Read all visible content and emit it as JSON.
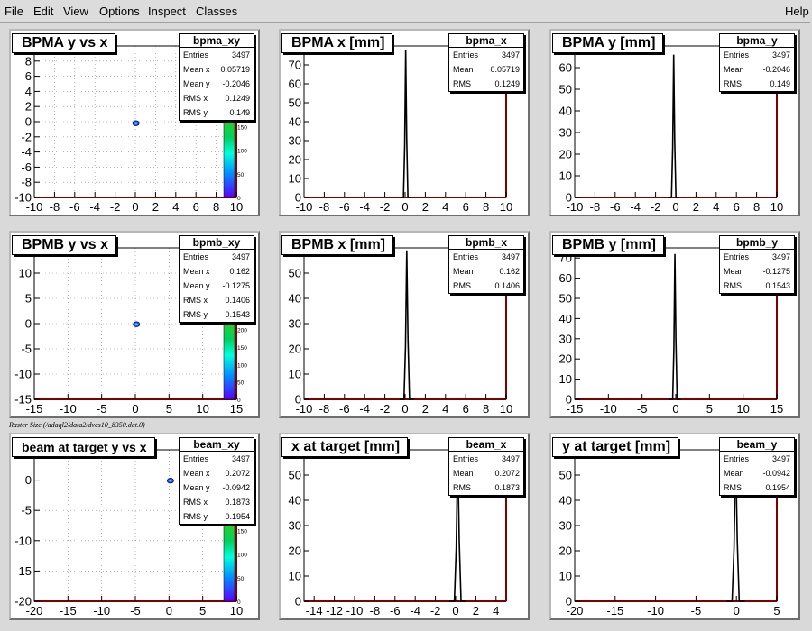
{
  "menu": {
    "file": "File",
    "edit": "Edit",
    "view": "View",
    "options": "Options",
    "inspect": "Inspect",
    "classes": "Classes",
    "help": "Help"
  },
  "caption": "Raster Size (/adaql2/data2/dvcs10_8350.dat.0)",
  "colors": {
    "hist_line": "#000000",
    "frame": "#800000",
    "grid": "#888888"
  },
  "pads": [
    {
      "id": "bpma-xy",
      "title": "BPMA y vs x",
      "type": "scatter2d",
      "stats": {
        "name": "bpma_xy",
        "rows": [
          [
            "Entries",
            "3497"
          ],
          [
            "Mean x",
            "0.05719"
          ],
          [
            "Mean y",
            "-0.2046"
          ],
          [
            "RMS x",
            "0.1249"
          ],
          [
            "RMS y",
            "0.149"
          ]
        ]
      },
      "xaxis": {
        "min": -10,
        "max": 10,
        "ticks": [
          "-10",
          "-8",
          "-6",
          "-4",
          "-2",
          "0",
          "2",
          "4",
          "6",
          "8",
          "10"
        ]
      },
      "yaxis": {
        "min": -10,
        "max": 10,
        "ticks": [
          "-10",
          "-8",
          "-6",
          "-4",
          "-2",
          "0",
          "2",
          "4",
          "6",
          "8"
        ]
      },
      "spot": {
        "x": 0.05719,
        "y": -0.2046
      },
      "palette_ticks": [
        "150",
        "100",
        "50",
        "0"
      ],
      "palette_max": 170
    },
    {
      "id": "bpma-x",
      "title": "BPMA x [mm]",
      "type": "hist1d",
      "stats": {
        "name": "bpma_x",
        "rows": [
          [
            "Entries",
            "3497"
          ],
          [
            "Mean",
            "0.05719"
          ],
          [
            "RMS",
            "0.1249"
          ]
        ]
      },
      "xaxis": {
        "min": -10,
        "max": 10,
        "ticks": [
          "-10",
          "-8",
          "-6",
          "-4",
          "-2",
          "0",
          "2",
          "4",
          "6",
          "8",
          "10"
        ]
      },
      "yaxis": {
        "min": 0,
        "max": 80,
        "ticks": [
          "0",
          "10",
          "20",
          "30",
          "40",
          "50",
          "60",
          "70",
          "80"
        ]
      },
      "peak": {
        "mean": 0.05719,
        "height": 78,
        "width": 0.4
      }
    },
    {
      "id": "bpma-y",
      "title": "BPMA y [mm]",
      "type": "hist1d",
      "stats": {
        "name": "bpma_y",
        "rows": [
          [
            "Entries",
            "3497"
          ],
          [
            "Mean",
            "-0.2046"
          ],
          [
            "RMS",
            "0.149"
          ]
        ]
      },
      "xaxis": {
        "min": -10,
        "max": 10,
        "ticks": [
          "-10",
          "-8",
          "-6",
          "-4",
          "-2",
          "0",
          "2",
          "4",
          "6",
          "8",
          "10"
        ]
      },
      "yaxis": {
        "min": 0,
        "max": 70,
        "ticks": [
          "0",
          "10",
          "20",
          "30",
          "40",
          "50",
          "60"
        ]
      },
      "peak": {
        "mean": -0.2046,
        "height": 66,
        "width": 0.4
      }
    },
    {
      "id": "bpmb-xy",
      "title": "BPMB y vs x",
      "type": "scatter2d",
      "stats": {
        "name": "bpmb_xy",
        "rows": [
          [
            "Entries",
            "3497"
          ],
          [
            "Mean x",
            "0.162"
          ],
          [
            "Mean y",
            "-0.1275"
          ],
          [
            "RMS x",
            "0.1406"
          ],
          [
            "RMS y",
            "0.1543"
          ]
        ]
      },
      "xaxis": {
        "min": -15,
        "max": 15,
        "ticks": [
          "-15",
          "-10",
          "-5",
          "0",
          "5",
          "10",
          "15"
        ]
      },
      "yaxis": {
        "min": -15,
        "max": 15,
        "ticks": [
          "-15",
          "-10",
          "-5",
          "0",
          "5",
          "10"
        ]
      },
      "spot": {
        "x": 0.162,
        "y": -0.1275
      },
      "palette_ticks": [
        "200",
        "150",
        "100",
        "50",
        "0"
      ],
      "palette_max": 230
    },
    {
      "id": "bpmb-x",
      "title": "BPMB x [mm]",
      "type": "hist1d",
      "stats": {
        "name": "bpmb_x",
        "rows": [
          [
            "Entries",
            "3497"
          ],
          [
            "Mean",
            "0.162"
          ],
          [
            "RMS",
            "0.1406"
          ]
        ]
      },
      "xaxis": {
        "min": -10,
        "max": 10,
        "ticks": [
          "-10",
          "-8",
          "-6",
          "-4",
          "-2",
          "0",
          "2",
          "4",
          "6",
          "8",
          "10"
        ]
      },
      "yaxis": {
        "min": 0,
        "max": 60,
        "ticks": [
          "0",
          "10",
          "20",
          "30",
          "40",
          "50",
          "60"
        ]
      },
      "peak": {
        "mean": 0.162,
        "height": 59,
        "width": 0.5
      }
    },
    {
      "id": "bpmb-y",
      "title": "BPMB y [mm]",
      "type": "hist1d",
      "stats": {
        "name": "bpmb_y",
        "rows": [
          [
            "Entries",
            "3497"
          ],
          [
            "Mean",
            "-0.1275"
          ],
          [
            "RMS",
            "0.1543"
          ]
        ]
      },
      "xaxis": {
        "min": -15,
        "max": 15,
        "ticks": [
          "-15",
          "-10",
          "-5",
          "0",
          "5",
          "10",
          "15"
        ]
      },
      "yaxis": {
        "min": 0,
        "max": 75,
        "ticks": [
          "0",
          "10",
          "20",
          "30",
          "40",
          "50",
          "60",
          "70"
        ]
      },
      "peak": {
        "mean": -0.1275,
        "height": 72,
        "width": 0.6
      }
    },
    {
      "id": "beam-xy",
      "title": "beam at target y vs x",
      "type": "scatter2d",
      "small_title": true,
      "stats": {
        "name": "beam_xy",
        "rows": [
          [
            "Entries",
            "3497"
          ],
          [
            "Mean x",
            "0.2072"
          ],
          [
            "Mean y",
            "-0.0942"
          ],
          [
            "RMS x",
            "0.1873"
          ],
          [
            "RMS y",
            "0.1954"
          ]
        ]
      },
      "xaxis": {
        "min": -20,
        "max": 10,
        "ticks": [
          "-20",
          "-15",
          "-10",
          "-5",
          "0",
          "5",
          "10"
        ]
      },
      "yaxis": {
        "min": -20,
        "max": 5,
        "ticks": [
          "-20",
          "-15",
          "-10",
          "-5",
          "0",
          "5"
        ]
      },
      "spot": {
        "x": 0.2072,
        "y": -0.0942
      },
      "palette_ticks": [
        "150",
        "100",
        "50",
        "0"
      ],
      "palette_max": 170
    },
    {
      "id": "beam-x",
      "title": "x at target [mm]",
      "type": "hist1d",
      "stats": {
        "name": "beam_x",
        "rows": [
          [
            "Entries",
            "3497"
          ],
          [
            "Mean",
            "0.2072"
          ],
          [
            "RMS",
            "0.1873"
          ]
        ]
      },
      "xaxis": {
        "min": -15,
        "max": 5,
        "ticks": [
          "-14",
          "-12",
          "-10",
          "-8",
          "-6",
          "-4",
          "-2",
          "0",
          "2",
          "4"
        ]
      },
      "yaxis": {
        "min": 0,
        "max": 60,
        "ticks": [
          "0",
          "10",
          "20",
          "30",
          "40",
          "50",
          "60"
        ]
      },
      "peak": {
        "mean": 0.2072,
        "height": 60,
        "width": 0.6
      }
    },
    {
      "id": "beam-y",
      "title": "y at target [mm]",
      "type": "hist1d",
      "stats": {
        "name": "beam_y",
        "rows": [
          [
            "Entries",
            "3497"
          ],
          [
            "Mean",
            "-0.0942"
          ],
          [
            "RMS",
            "0.1954"
          ]
        ]
      },
      "xaxis": {
        "min": -20,
        "max": 5,
        "ticks": [
          "-20",
          "-15",
          "-10",
          "-5",
          "0",
          "5"
        ]
      },
      "yaxis": {
        "min": 0,
        "max": 60,
        "ticks": [
          "0",
          "10",
          "20",
          "30",
          "40",
          "50",
          "60"
        ]
      },
      "peak": {
        "mean": -0.0942,
        "height": 60,
        "width": 0.8
      }
    }
  ]
}
